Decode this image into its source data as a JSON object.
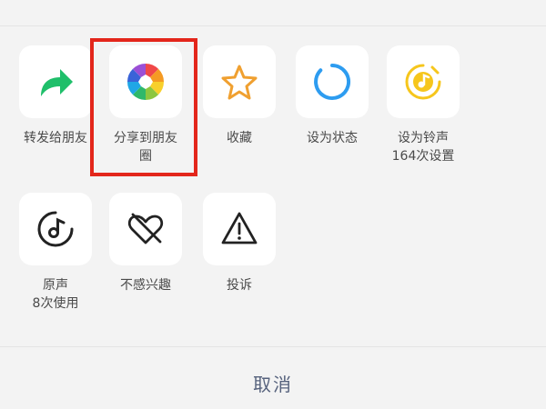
{
  "share_sheet": {
    "row1": [
      {
        "label": "转发给朋友",
        "label2": "",
        "icon": "forward-arrow-icon"
      },
      {
        "label": "分享到朋友",
        "label2": "圈",
        "icon": "moments-aperture-icon"
      },
      {
        "label": "收藏",
        "label2": "",
        "icon": "star-icon"
      },
      {
        "label": "设为状态",
        "label2": "",
        "icon": "status-circle-icon"
      },
      {
        "label": "设为铃声",
        "label2": "164次设置",
        "icon": "ringtone-icon"
      }
    ],
    "row2": [
      {
        "label": "原声",
        "label2": "8次使用",
        "icon": "original-sound-icon"
      },
      {
        "label": "不感兴趣",
        "label2": "",
        "icon": "not-interested-heart-icon"
      },
      {
        "label": "投诉",
        "label2": "",
        "icon": "warning-triangle-icon"
      }
    ],
    "cancel_label": "取消",
    "colors": {
      "highlight": "#e3261b",
      "forward_green": "#1fbf6a",
      "star_orange": "#f0a030",
      "status_blue": "#2d9cf0",
      "ringtone_yellow": "#f6c61c",
      "cancel_text": "#56627d"
    }
  }
}
